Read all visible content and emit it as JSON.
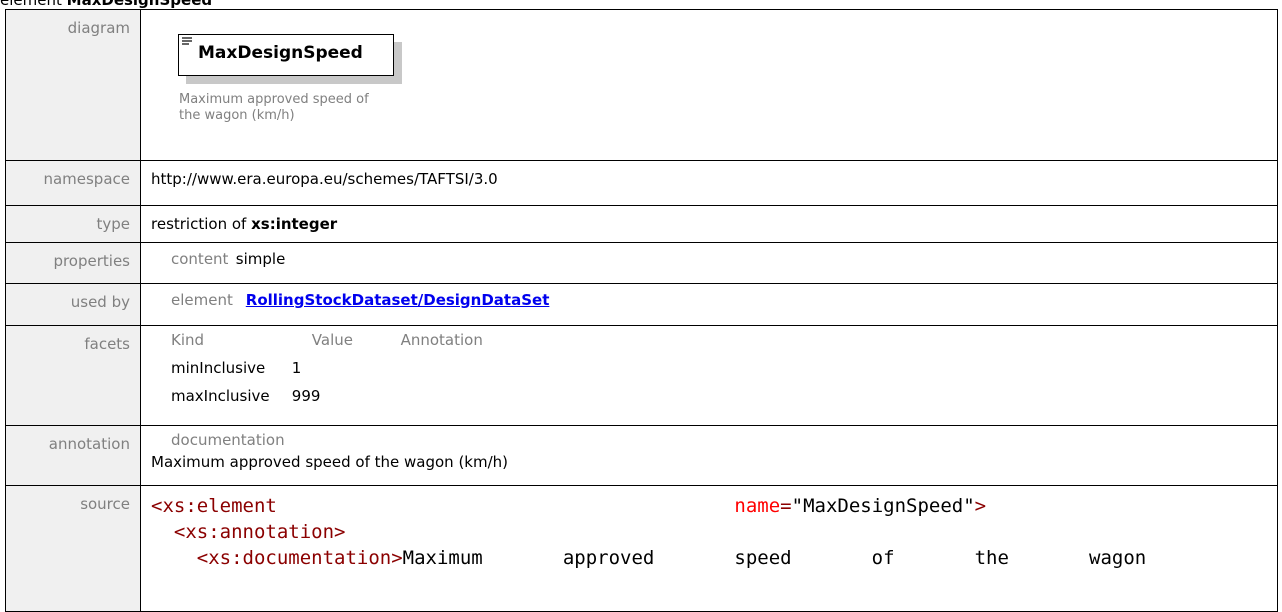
{
  "title": {
    "prefix": "element",
    "name": "MaxDesignSpeed"
  },
  "labels": {
    "diagram": "diagram",
    "namespace": "namespace",
    "type": "type",
    "properties": "properties",
    "used_by": "used by",
    "facets": "facets",
    "annotation": "annotation",
    "source": "source"
  },
  "diagram": {
    "element_name": "MaxDesignSpeed",
    "documentation": "Maximum approved speed of the wagon (km/h)",
    "icon": "documentation-lines-icon"
  },
  "namespace": "http://www.era.europa.eu/schemes/TAFTSI/3.0",
  "type": {
    "prefix": "restriction of",
    "base": "xs:integer"
  },
  "properties": {
    "key": "content",
    "value": "simple"
  },
  "used_by": {
    "kind": "element",
    "link": "RollingStockDataset/DesignDataSet"
  },
  "facets": {
    "headers": [
      "Kind",
      "Value",
      "Annotation"
    ],
    "rows": [
      {
        "kind": "minInclusive",
        "value": "1"
      },
      {
        "kind": "maxInclusive",
        "value": "999"
      }
    ]
  },
  "annotation": {
    "head": "documentation",
    "text": "Maximum approved speed of the wagon (km/h)"
  },
  "source": {
    "line1_tag": "<xs:element",
    "line1_attr": "name",
    "line1_eq": "=",
    "line1_val": "\"MaxDesignSpeed\"",
    "line1_close": ">",
    "line2_tag": "<xs:annotation>",
    "line3_tag": "<xs:documentation>",
    "line3_text": "Maximum       approved       speed       of       the       wagon"
  },
  "colors": {
    "label_bg": "#f0f0f0",
    "label_text": "#808080",
    "link": "#0000ee",
    "xml_tag": "#8b0000",
    "xml_attr": "#ff0000"
  }
}
